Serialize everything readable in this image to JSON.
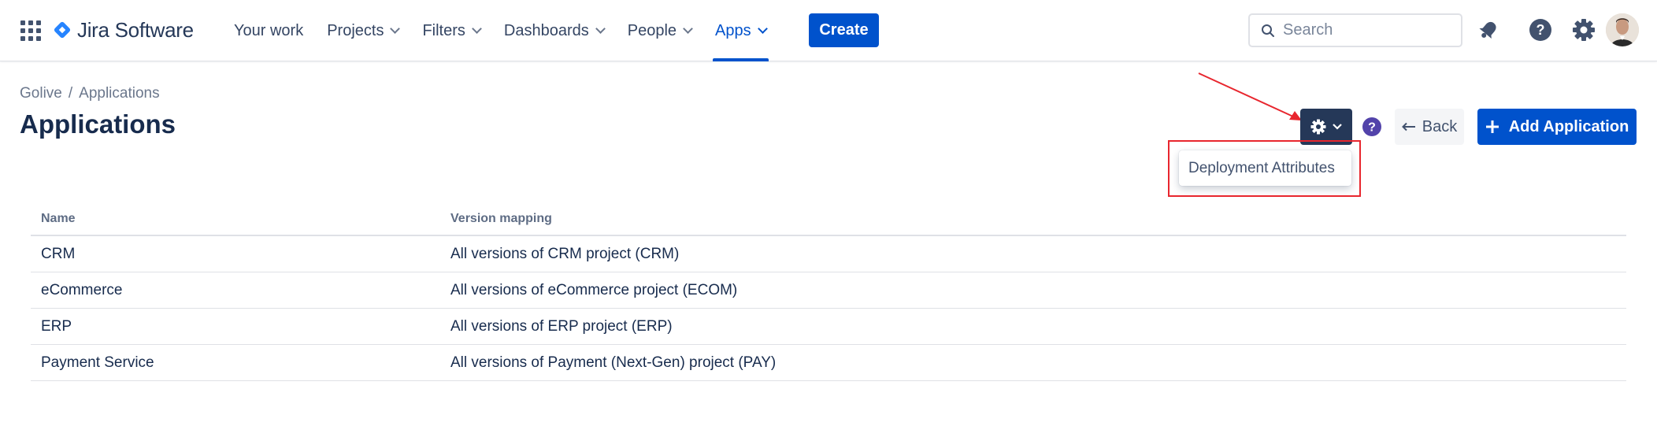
{
  "nav": {
    "logo_text": "Jira Software",
    "items": [
      {
        "label": "Your work",
        "has_chevron": false
      },
      {
        "label": "Projects",
        "has_chevron": true
      },
      {
        "label": "Filters",
        "has_chevron": true
      },
      {
        "label": "Dashboards",
        "has_chevron": true
      },
      {
        "label": "People",
        "has_chevron": true
      },
      {
        "label": "Apps",
        "has_chevron": true,
        "active": true
      }
    ],
    "create_label": "Create",
    "search_placeholder": "Search"
  },
  "breadcrumb": {
    "root": "Golive",
    "separator": "/",
    "current": "Applications"
  },
  "page_title": "Applications",
  "toolbar": {
    "back_label": "Back",
    "add_label": "Add Application"
  },
  "dropdown": {
    "items": [
      "Deployment Attributes"
    ]
  },
  "table": {
    "headers": [
      "Name",
      "Version mapping"
    ],
    "rows": [
      [
        "CRM",
        "All versions of CRM project (CRM)"
      ],
      [
        "eCommerce",
        "All versions of eCommerce project (ECOM)"
      ],
      [
        "ERP",
        "All versions of ERP project (ERP)"
      ],
      [
        "Payment Service",
        "All versions of Payment (Next-Gen) project (PAY)"
      ]
    ]
  },
  "colors": {
    "brand": "#0052cc",
    "annotation": "#e8262e",
    "dark_button": "#253858",
    "help": "#5243aa"
  }
}
